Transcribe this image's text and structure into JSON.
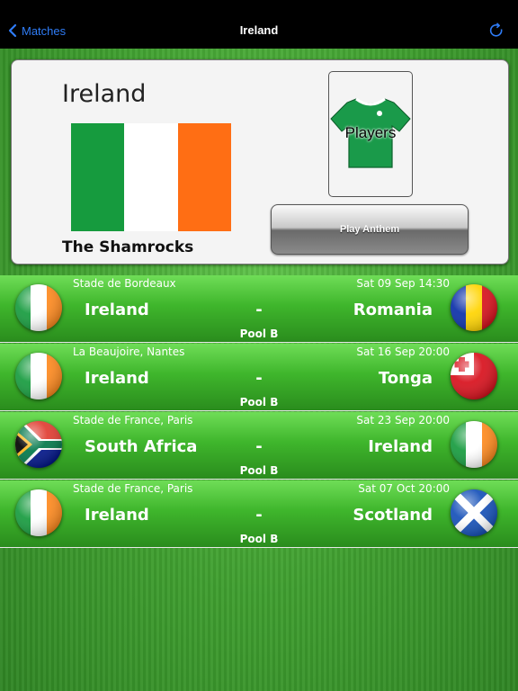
{
  "nav": {
    "back_label": "Matches",
    "title": "Ireland"
  },
  "team": {
    "name": "Ireland",
    "nickname": "The Shamrocks",
    "flag_colors": [
      "#169b3e",
      "#ffffff",
      "#ff6e14"
    ],
    "players_label": "Players",
    "anthem_label": "Play Anthem"
  },
  "matches": [
    {
      "venue": "Stade de Bordeaux",
      "datetime": "Sat 09 Sep 14:30",
      "home": "Ireland",
      "sep": "-",
      "away": "Romania",
      "pool": "Pool B"
    },
    {
      "venue": "La Beaujoire, Nantes",
      "datetime": "Sat 16 Sep 20:00",
      "home": "Ireland",
      "sep": "-",
      "away": "Tonga",
      "pool": "Pool B"
    },
    {
      "venue": "Stade de France, Paris",
      "datetime": "Sat 23 Sep 20:00",
      "home": "South Africa",
      "sep": "-",
      "away": "Ireland",
      "pool": "Pool B"
    },
    {
      "venue": "Stade de France, Paris",
      "datetime": "Sat 07 Oct 20:00",
      "home": "Ireland",
      "sep": "-",
      "away": "Scotland",
      "pool": "Pool B"
    }
  ],
  "colors": {
    "accent": "#2f7cf6",
    "row_green": "#3fb62c",
    "jersey_green": "#1a9a4a"
  }
}
